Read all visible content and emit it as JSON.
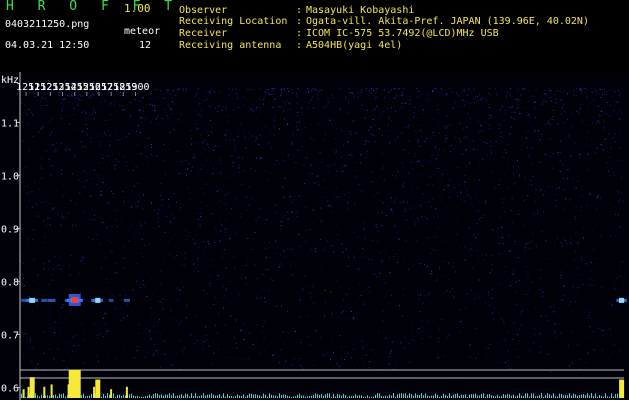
{
  "header": {
    "app_name": "H R O F F T",
    "version": "1.00",
    "filename": "0403211250.png",
    "meteor_label": "meteor",
    "meteor_count": "12",
    "datetime": "04.03.21 12:50",
    "info": [
      {
        "label": "Observer",
        "value": "Masayuki Kobayashi"
      },
      {
        "label": "Receiving Location",
        "value": "Ogata-vill. Akita-Pref. JAPAN (139.96E, 40.02N)"
      },
      {
        "label": "Receiver",
        "value": "ICOM IC-575 53.7492(@LCD)MHz USB"
      },
      {
        "label": "Receiving antenna",
        "value": "A504HB(yagi 4el)"
      }
    ],
    "colon": ":"
  },
  "chart_data": {
    "type": "heatmap",
    "ylabel": "kHz",
    "x_ticks": [
      "1251",
      "1252",
      "1253",
      "1254",
      "1255",
      "1256",
      "1257",
      "1258",
      "1259",
      "1300"
    ],
    "y_ticks": [
      1.1,
      1.0,
      0.9,
      0.8,
      0.7,
      0.6
    ],
    "y_tick_labels": [
      "1.1",
      "1.0",
      "0.9",
      "0.8",
      "0.7",
      "0.6"
    ],
    "ylim": [
      0.58,
      1.18
    ],
    "xlim": [
      1250.5,
      1300.2
    ],
    "echo_band_khz": 0.765,
    "echoes": [
      {
        "time": 1250.8,
        "strength": 0.2
      },
      {
        "time": 1251.2,
        "strength": 0.3
      },
      {
        "time": 1251.5,
        "strength": 0.7
      },
      {
        "time": 1252.5,
        "strength": 0.3
      },
      {
        "time": 1253.1,
        "strength": 0.4
      },
      {
        "time": 1254.5,
        "strength": 0.4
      },
      {
        "time": 1255.0,
        "strength": 1.0
      },
      {
        "time": 1256.6,
        "strength": 0.3
      },
      {
        "time": 1256.9,
        "strength": 0.6
      },
      {
        "time": 1258.0,
        "strength": 0.2
      },
      {
        "time": 1259.3,
        "strength": 0.3
      },
      {
        "time": 1300.0,
        "strength": 0.6
      }
    ]
  }
}
